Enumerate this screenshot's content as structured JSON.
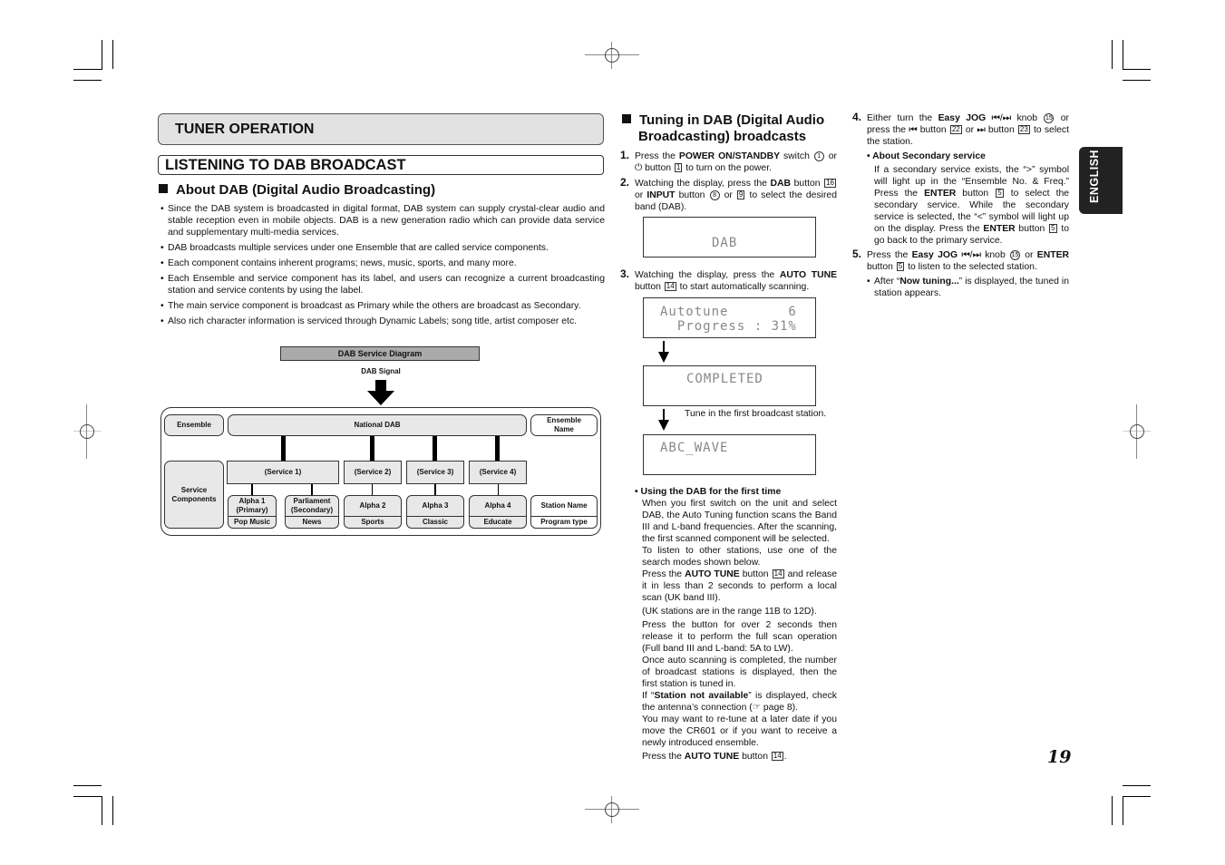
{
  "page": {
    "section_header": "TUNER OPERATION",
    "title": "LISTENING TO DAB BROADCAST",
    "language_tab": "ENGLISH",
    "page_number": "19"
  },
  "about": {
    "heading": "About DAB (Digital Audio Broadcasting)",
    "bullets": [
      "Since the DAB system is broadcasted in digital format, DAB system can supply crystal-clear audio and stable reception even in mobile objects. DAB is a new generation radio which can provide data service and supplementary multi-media services.",
      "DAB broadcasts multiple services under one Ensemble that are called service components.",
      "Each component contains inherent programs; news, music, sports, and many more.",
      "Each Ensemble and service component has its label, and users can recognize a current broadcasting station and service contents by using the label.",
      "The main service component is broadcast as Primary while the others are broadcast as Secondary.",
      "Also rich character information is serviced through Dynamic Labels; song title, artist composer etc."
    ]
  },
  "diagram": {
    "title": "DAB Service Diagram",
    "signal_label": "DAB Signal",
    "ensemble_label": "Ensemble",
    "ensemble_value": "National DAB",
    "ensemble_name_label": "Ensemble Name",
    "service_components_label": "Service Components",
    "services": [
      "(Service 1)",
      "(Service 2)",
      "(Service 3)",
      "(Service 4)"
    ],
    "components": [
      {
        "name": "Alpha 1 (Primary)",
        "type": "Pop Music"
      },
      {
        "name": "Parliament (Secondary)",
        "type": "News"
      },
      {
        "name": "Alpha 2",
        "type": "Sports"
      },
      {
        "name": "Alpha 3",
        "type": "Classic"
      },
      {
        "name": "Alpha 4",
        "type": "Educate"
      }
    ],
    "legend_station": "Station Name",
    "legend_program": "Program type"
  },
  "tuning": {
    "heading_line1": "Tuning in DAB (Digital Audio",
    "heading_line2": "Broadcasting) broadcasts",
    "steps": [
      {
        "num": "1.",
        "pre": "Press the ",
        "bold": "POWER ON/STANDBY",
        "post": " switch",
        "ref1": "1",
        "mid": " or ",
        "icon": "⏻",
        "post2": " button",
        "ref2": "1",
        "end": " to turn on the power."
      },
      {
        "num": "2.",
        "text": "Watching the display, press the DAB button 16 or INPUT button 8 or 9 to select the desired band (DAB).",
        "bold1": "DAB",
        "bold2": "INPUT",
        "ref_dab": "16",
        "ref_in1": "8",
        "ref_in2": "9"
      },
      {
        "num": "3.",
        "pre": "Watching the display, press the ",
        "bold": "AUTO TUNE",
        "post": " button",
        "ref": "14",
        "end": " to start automatically scanning."
      },
      {
        "num": "4.",
        "bold": "Easy JOG",
        "ref_knob": "15",
        "ref_prev": "22",
        "ref_next": "23"
      },
      {
        "num": "5.",
        "bold": "Easy JOG",
        "bold2": "ENTER",
        "ref_knob": "15",
        "ref_enter": "5"
      }
    ],
    "lcd": {
      "dab": "DAB",
      "autotune_line1": "Autotune       6",
      "autotune_line2": "  Progress : 31%",
      "completed": "COMPLETED",
      "station": "ABC_WAVE"
    },
    "completed_note": "Tune in the first broadcast station.",
    "first_time": {
      "heading": "Using the DAB for the first time",
      "p1": "When you first switch on the unit and select DAB, the Auto Tuning function scans the Band III and L-band frequencies. After the scanning, the first scanned component will be selected.",
      "p2": "To listen to other stations, use one of the search modes shown below.",
      "p3_pre": "Press the ",
      "p3_bold": "AUTO TUNE",
      "p3_mid": " button",
      "p3_ref": "14",
      "p3_post": " and release it in less than 2 seconds to perform a local scan (UK band III).",
      "p4": "(UK stations are in the range 11B to 12D).",
      "p5": "Press the button for over 2 seconds then release it to perform the full scan operation (Full band III and L-band: 5A to LW).",
      "p6": "Once auto scanning is completed, the number of broadcast stations is displayed, then the first station is tuned in.",
      "p7_pre": "If “",
      "p7_bold": "Station not available",
      "p7_post": "” is displayed, check the antenna’s connection (☞ page 8).",
      "p8": "You may want to re-tune at a later date if you move the CR601 or if you want to receive a newly introduced ensemble.",
      "p9_pre": "Press the ",
      "p9_bold": "AUTO TUNE",
      "p9_mid": " button",
      "p9_ref": "14"
    },
    "secondary": {
      "heading": "About Secondary service",
      "text_pre": "If a secondary service exists, the “>” symbol will light up in the “Ensemble No. & Freq.” Press the ",
      "bold": "ENTER",
      "mid": " button",
      "ref": "5",
      "text_mid": " to select the secondary service. While the secondary service is selected, the “<” symbol will light up on the display. Press the ",
      "text_end": " to go back to the primary service."
    },
    "after_tuning": {
      "pre": "After “",
      "bold": "Now tuning...",
      "post": "” is displayed, the tuned in station appears."
    }
  }
}
